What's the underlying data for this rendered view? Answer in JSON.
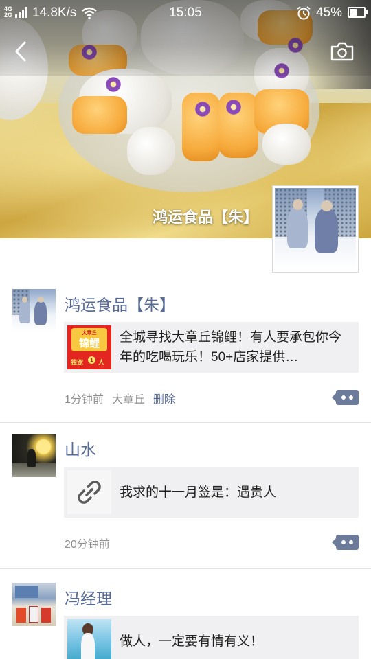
{
  "status_bar": {
    "network": "4G\n2G",
    "speed": "14.8K/s",
    "time": "15:05",
    "battery": "45%"
  },
  "header": {
    "cover_name": "鸿运食品【朱】",
    "back_icon": "chevron-left-icon",
    "camera_icon": "camera-icon"
  },
  "thumb_text": {
    "top": "大章丘",
    "mid": "锦鲤",
    "left": "独宠",
    "num": "1",
    "right": "人"
  },
  "moments": [
    {
      "name": "鸿运食品【朱】",
      "link": "全城寻找大章丘锦鲤！有人要承包你今年的吃喝玩乐！50+店家提供…",
      "time": "1分钟前",
      "location": "大章丘",
      "delete": "删除"
    },
    {
      "name": "山水",
      "link": "我求的十一月签是：遇贵人",
      "time": "20分钟前"
    },
    {
      "name": "冯经理",
      "link": "做人，一定要有情有义！"
    }
  ],
  "colors": {
    "name_blue": "#576b95",
    "card_bg": "#f0f0f2",
    "comment_button": "#6c7b99"
  }
}
